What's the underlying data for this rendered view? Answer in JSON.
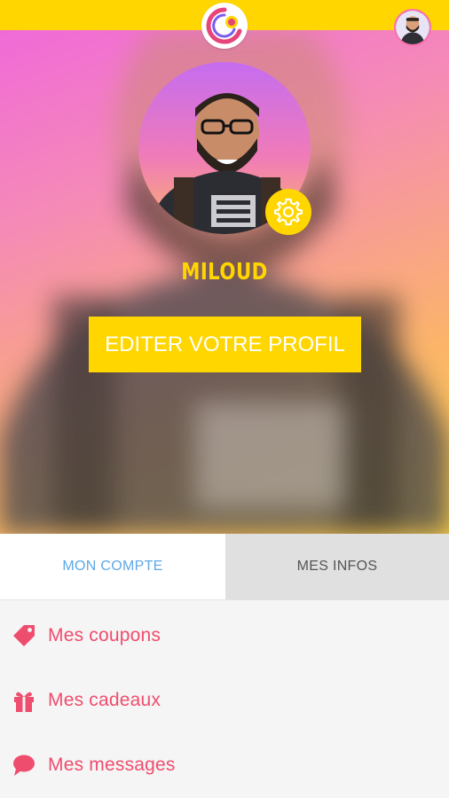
{
  "app": {
    "logo_icon": "app-logo-icon",
    "accent_color": "#ffd600",
    "menu_text_color": "#ef4d6e",
    "active_tab_color": "#5fa8e6"
  },
  "profile": {
    "username": "MILOUD",
    "edit_button_label": "EDITER VOTRE PROFIL",
    "settings_icon": "gear-icon"
  },
  "tabs": [
    {
      "label": "MON COMPTE",
      "active": true
    },
    {
      "label": "MES INFOS",
      "active": false
    }
  ],
  "menu": {
    "items": [
      {
        "label": "Mes coupons",
        "icon": "tag-icon"
      },
      {
        "label": "Mes cadeaux",
        "icon": "gift-icon"
      },
      {
        "label": "Mes messages",
        "icon": "chat-bubble-icon"
      }
    ]
  }
}
